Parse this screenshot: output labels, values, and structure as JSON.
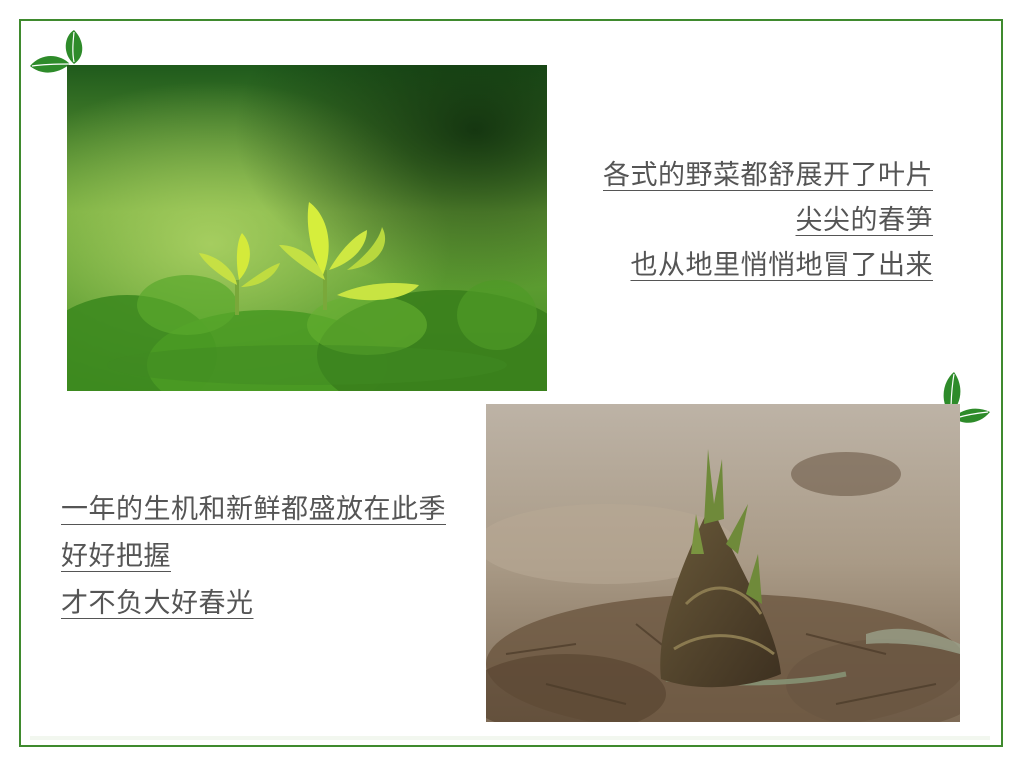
{
  "colors": {
    "frame": "#3f8a2e",
    "leaf": "#2e8b2a",
    "text": "#555555"
  },
  "icons": {
    "top_left": "leaf-pair-icon",
    "right": "leaf-pair-icon"
  },
  "poem_right": {
    "lines": [
      "各式的野菜都舒展开了叶片",
      "尖尖的春笋",
      "也从地里悄悄地冒了出来"
    ]
  },
  "poem_left": {
    "lines": [
      "一年的生机和新鲜都盛放在此季",
      "好好把握",
      "才不负大好春光"
    ]
  }
}
